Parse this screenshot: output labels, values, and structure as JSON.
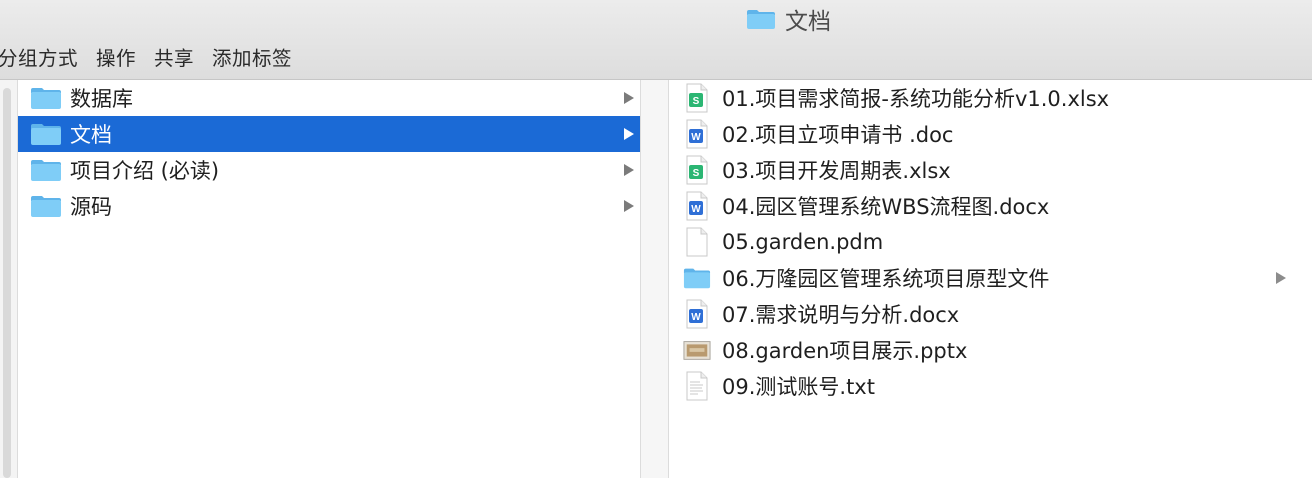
{
  "window": {
    "title": "文档"
  },
  "toolbar": {
    "items": [
      "分组方式",
      "操作",
      "共享",
      "添加标签"
    ]
  },
  "column1": {
    "items": [
      {
        "label": "数据库",
        "selected": false
      },
      {
        "label": "文档",
        "selected": true
      },
      {
        "label": "项目介绍 (必读)",
        "selected": false
      },
      {
        "label": "源码",
        "selected": false
      }
    ]
  },
  "column2": {
    "items": [
      {
        "label": "01.项目需求简报-系统功能分析v1.0.xlsx",
        "icon": "spreadsheet-file-icon"
      },
      {
        "label": "02.项目立项申请书 .doc",
        "icon": "word-document-icon"
      },
      {
        "label": "03.项目开发周期表.xlsx",
        "icon": "spreadsheet-file-icon"
      },
      {
        "label": "04.园区管理系统WBS流程图.docx",
        "icon": "word-document-icon"
      },
      {
        "label": "05.garden.pdm",
        "icon": "blank-document-icon"
      },
      {
        "label": "06.万隆园区管理系统项目原型文件",
        "icon": "folder-icon"
      },
      {
        "label": "07.需求说明与分析.docx",
        "icon": "word-document-icon"
      },
      {
        "label": "08.garden项目展示.pptx",
        "icon": "presentation-thumbnail-icon"
      },
      {
        "label": "09.测试账号.txt",
        "icon": "text-file-icon"
      }
    ]
  },
  "colors": {
    "selection": "#1b6ad6",
    "folder": "#6cc2f5"
  }
}
